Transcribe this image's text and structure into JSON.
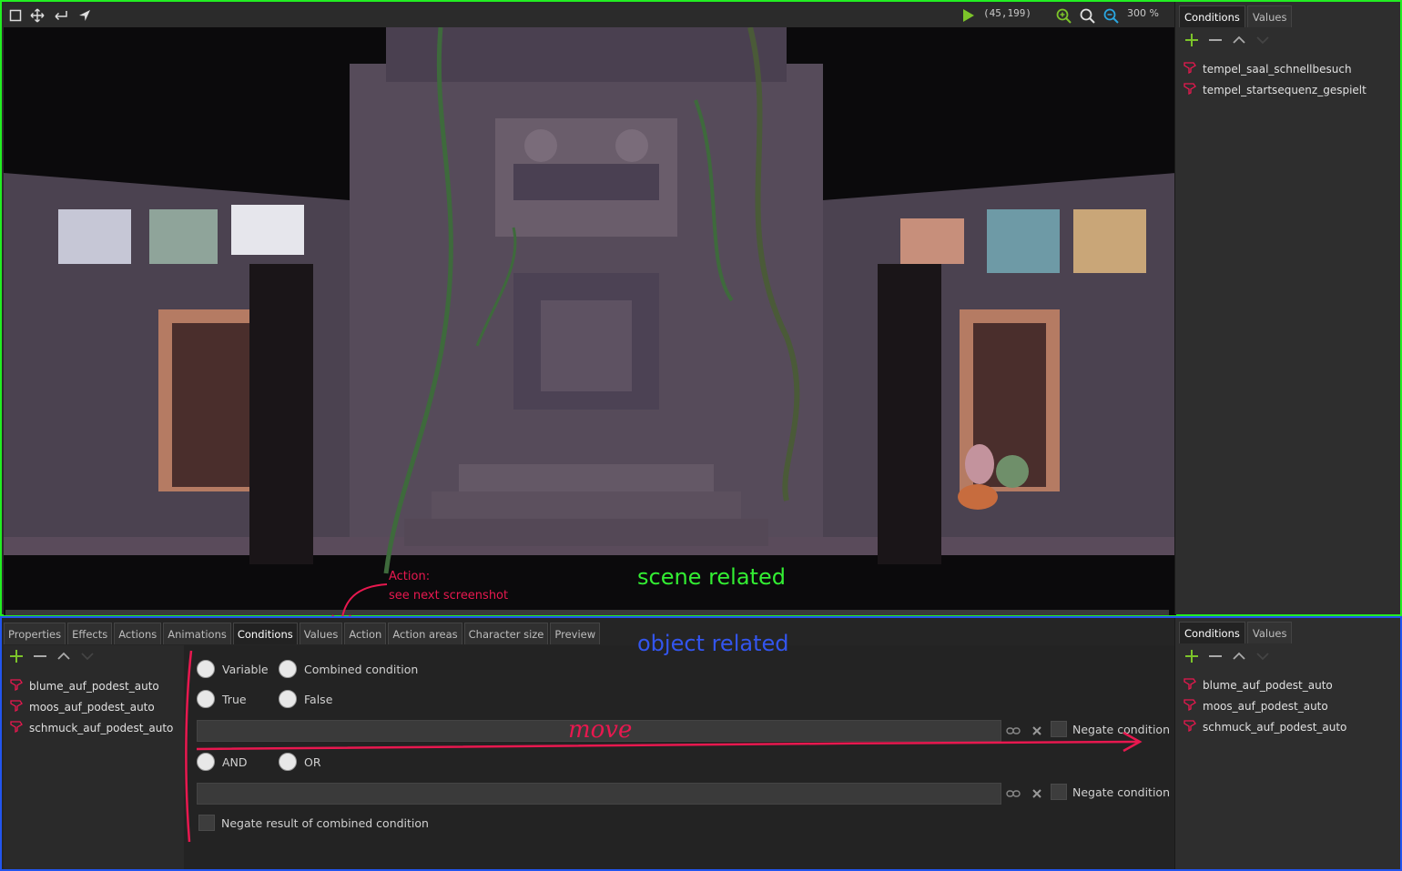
{
  "toolbar": {
    "coords": "(45,199)",
    "zoom": "300 %"
  },
  "scene_panel": {
    "tabs": [
      "Conditions",
      "Values"
    ],
    "active_tab": "Conditions",
    "items": [
      "tempel_saal_schnellbesuch",
      "tempel_startsequenz_gespielt"
    ]
  },
  "object_tabs": [
    "Properties",
    "Effects",
    "Actions",
    "Animations",
    "Conditions",
    "Values",
    "Action",
    "Action areas",
    "Character size",
    "Preview"
  ],
  "object_left": {
    "items": [
      "blume_auf_podest_auto",
      "moos_auf_podest_auto",
      "schmuck_auf_podest_auto"
    ]
  },
  "object_main": {
    "radio_variable": "Variable",
    "radio_combined": "Combined condition",
    "radio_true": "True",
    "radio_false": "False",
    "negate_1": "Negate condition",
    "radio_and": "AND",
    "radio_or": "OR",
    "negate_2": "Negate condition",
    "negate_combined": "Negate result of combined condition"
  },
  "object_right": {
    "tabs": [
      "Conditions",
      "Values"
    ],
    "active_tab": "Conditions",
    "items": [
      "blume_auf_podest_auto",
      "moos_auf_podest_auto",
      "schmuck_auf_podest_auto"
    ]
  },
  "annotations": {
    "scene_related": "scene related",
    "object_related": "object related",
    "action_note_1": "Action:",
    "action_note_2": "see next screenshot",
    "move": "move"
  },
  "colors": {
    "scene_border": "#22ee22",
    "object_border": "#2255ee",
    "scene_label": "#33ee33",
    "object_label": "#3355ee",
    "annotation": "#e8184f"
  }
}
